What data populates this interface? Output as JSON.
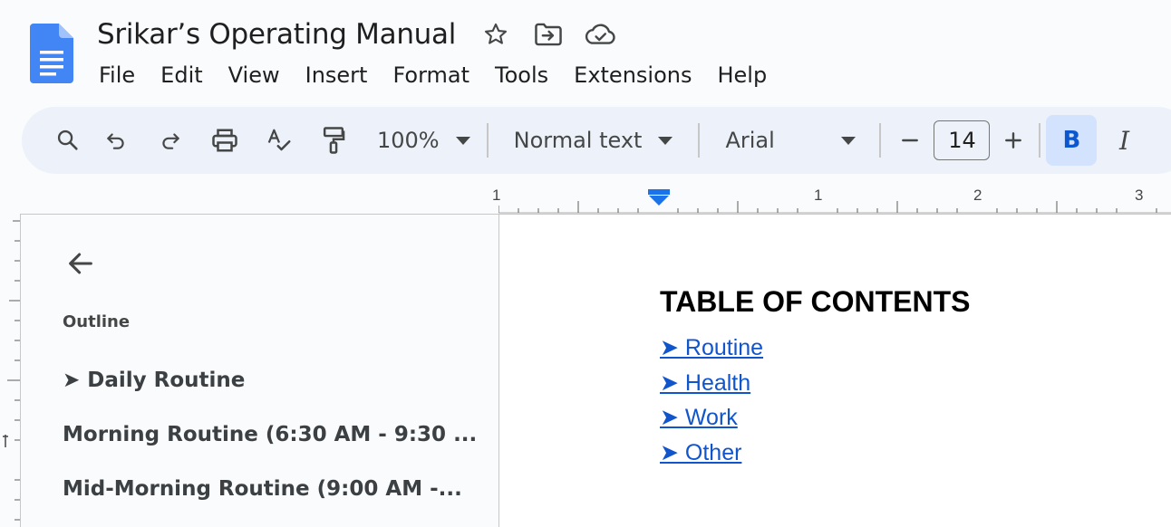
{
  "document": {
    "title": "Srikar’s Operating Manual"
  },
  "menu": [
    "File",
    "Edit",
    "View",
    "Insert",
    "Format",
    "Tools",
    "Extensions",
    "Help"
  ],
  "toolbar": {
    "zoom": "100%",
    "style": "Normal text",
    "font": "Arial",
    "font_size": "14",
    "bold_label": "B",
    "italic_label": "I"
  },
  "ruler": {
    "labels": [
      "1",
      "1",
      "2",
      "3"
    ]
  },
  "outline": {
    "label": "Outline",
    "items": [
      "➤ Daily Routine",
      "Morning Routine (6:30 AM - 9:30 ...",
      "Mid-Morning Routine (9:00 AM -..."
    ]
  },
  "page": {
    "toc_title": "TABLE OF CONTENTS",
    "links": [
      "➤ Routine",
      "➤ Health",
      "➤ Work",
      "➤ Other"
    ]
  },
  "colors": {
    "accent": "#0b57d0",
    "link": "#1155cc",
    "toolbar_bg": "#edf2fa",
    "logo": "#4285f4"
  }
}
